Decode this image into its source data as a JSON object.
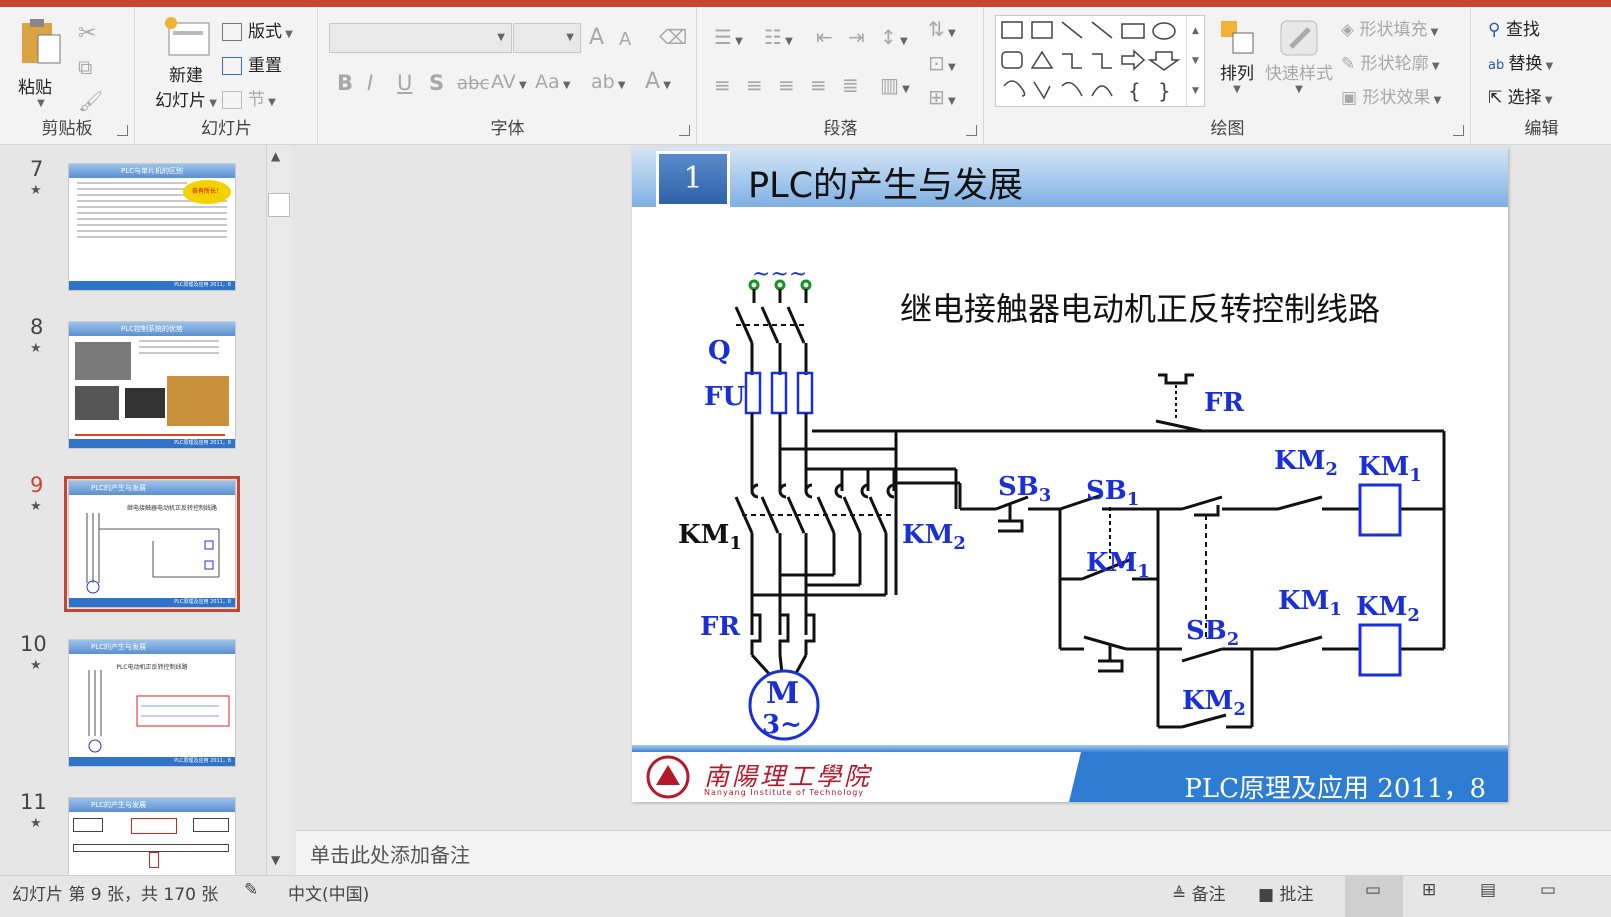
{
  "ribbon": {
    "clipboard": {
      "label": "剪贴板",
      "paste": "粘贴"
    },
    "slides": {
      "label": "幻灯片",
      "new_slide_line1": "新建",
      "new_slide_line2": "幻灯片",
      "layout": "版式",
      "reset": "重置",
      "section": "节"
    },
    "font": {
      "label": "字体"
    },
    "paragraph": {
      "label": "段落"
    },
    "drawing": {
      "label": "绘图",
      "arrange": "排列",
      "quick_styles": "快速样式",
      "shape_fill": "形状填充",
      "shape_outline": "形状轮廓",
      "shape_effects": "形状效果"
    },
    "editing": {
      "label": "编辑",
      "find": "查找",
      "replace": "替换",
      "select": "选择"
    }
  },
  "thumbnails": [
    {
      "num": "7",
      "title": "PLC与单片机的区别",
      "badge": "各有所长！",
      "footer": "PLC原理及应用  2011，8"
    },
    {
      "num": "8",
      "title": "PLC控制系统的优势",
      "footer": "PLC原理及应用  2011，8"
    },
    {
      "num": "9",
      "title": "PLC的产生与发展",
      "subtitle": "继电接触器电动机正反转控制线路",
      "footer": "PLC原理及应用  2011，8"
    },
    {
      "num": "10",
      "title": "PLC的产生与发展",
      "subtitle": "PLC电动机正反转控制线路",
      "footer": "PLC原理及应用  2011，8"
    },
    {
      "num": "11",
      "title": "PLC的产生与发展",
      "footer": ""
    }
  ],
  "slide": {
    "number": "1",
    "title": "PLC的产生与发展",
    "diagram_title": "继电接触器电动机正反转控制线路",
    "labels": {
      "tilde": "~~~",
      "q": "Q",
      "fu": "FU",
      "fr_top": "FR",
      "km1": "KM",
      "km2": "KM",
      "fr": "FR",
      "motor_m": "M",
      "motor_3": "3~",
      "sb3": "SB",
      "sb1": "SB",
      "sb2": "SB",
      "sub1": "1",
      "sub2": "2",
      "sub3": "3"
    },
    "footer_course": "PLC原理及应用   2011，8",
    "footer_school": "南陽理工學院",
    "footer_school_en": "Nanyang Institute of Technology"
  },
  "notes_placeholder": "单击此处添加备注",
  "status": {
    "slide_info": "幻灯片 第 9 张，共 170 张",
    "language": "中文(中国)",
    "notes": "备注",
    "comments": "批注"
  },
  "colors": {
    "accent": "#c8452f",
    "slide_blue": "#2f7dd2",
    "label_blue": "#1a2fd6"
  }
}
